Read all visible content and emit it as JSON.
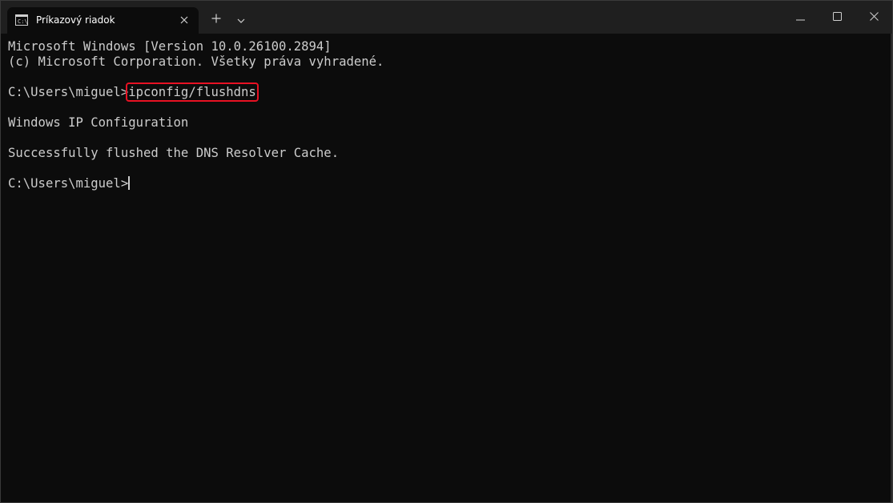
{
  "window": {
    "tab_title": "Príkazový riadok",
    "icons": {
      "tab": "terminal-icon",
      "tab_close": "close-icon",
      "new_tab": "plus-icon",
      "dropdown": "chevron-down-icon",
      "minimize": "minimize-icon",
      "maximize": "maximize-icon",
      "close": "close-icon"
    }
  },
  "terminal": {
    "lines": [
      "Microsoft Windows [Version 10.0.26100.2894]",
      "(c) Microsoft Corporation. Všetky práva vyhradené.",
      "",
      "",
      "Windows IP Configuration",
      "",
      "Successfully flushed the DNS Resolver Cache.",
      "",
      ""
    ],
    "prompt_1": "C:\\Users\\miguel>",
    "command_1": "ipconfig/flushdns",
    "prompt_2": "C:\\Users\\miguel>"
  },
  "colors": {
    "terminal_bg": "#0c0c0c",
    "titlebar_bg": "#1f1f1f",
    "text": "#cccccc",
    "highlight_box": "#e81123"
  }
}
